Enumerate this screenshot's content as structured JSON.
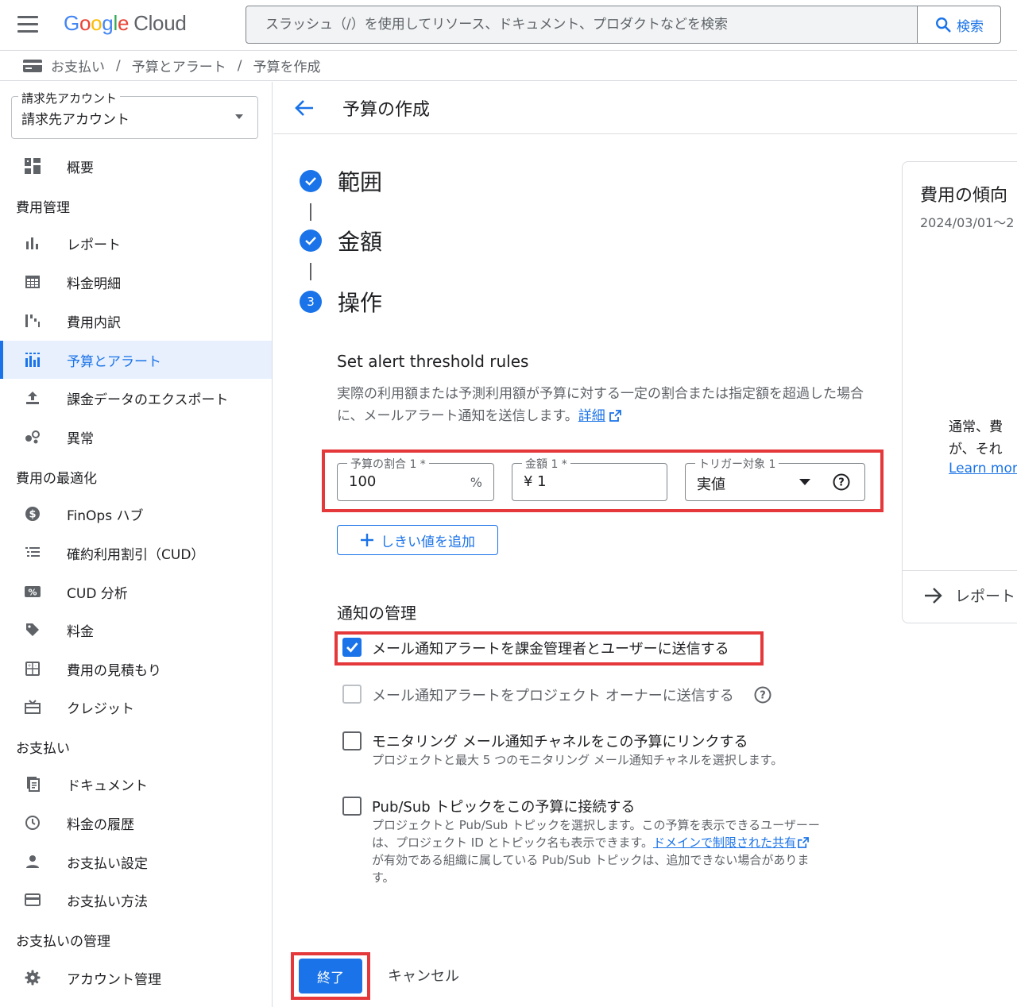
{
  "topbar": {
    "logo_letters": [
      "G",
      "o",
      "o",
      "g",
      "l",
      "e"
    ],
    "logo_cloud": "Cloud",
    "search_placeholder": "スラッシュ（/）を使用してリソース、ドキュメント、プロダクトなどを検索",
    "search_button": "検索"
  },
  "breadcrumb": {
    "items": [
      "お支払い",
      "予算とアラート",
      "予算を作成"
    ],
    "separator": "/"
  },
  "sidebar": {
    "account_label": "請求先アカウント",
    "account_value": "請求先アカウント",
    "overview": "概要",
    "sections": {
      "cost_management": "費用管理",
      "optimization": "費用の最適化",
      "payments": "お支払い",
      "payment_admin": "お支払いの管理"
    },
    "items": {
      "reports": "レポート",
      "pricing_table": "料金明細",
      "cost_breakdown": "費用内訳",
      "budgets": "予算とアラート",
      "export": "課金データのエクスポート",
      "anomalies": "異常",
      "finops": "FinOps ハブ",
      "cud": "確約利用割引（CUD）",
      "cud_analysis": "CUD 分析",
      "pricing": "料金",
      "estimate": "費用の見積もり",
      "credits": "クレジット",
      "documents": "ドキュメント",
      "transactions": "料金の履歴",
      "payment_settings": "お支払い設定",
      "payment_method": "お支払い方法",
      "account_management": "アカウント管理"
    }
  },
  "main": {
    "title": "予算の作成",
    "steps": [
      {
        "label": "範囲",
        "state": "done"
      },
      {
        "label": "金額",
        "state": "done"
      },
      {
        "label": "操作",
        "state": "active",
        "number": "3"
      }
    ],
    "rules_heading": "Set alert threshold rules",
    "rules_desc": "実際の利用額または予測利用額が予算に対する一定の割合または指定額を超過した場合に、メールアラート通知を送信します。",
    "rules_link": "詳細",
    "threshold": {
      "percent_label": "予算の割合 1 *",
      "percent_value": "100",
      "percent_suffix": "%",
      "amount_label": "金額 1 *",
      "amount_value": "¥ 1",
      "trigger_label": "トリガー対象 1",
      "trigger_value": "実値"
    },
    "add_threshold": "しきい値を追加",
    "notify_heading": "通知の管理",
    "checkboxes": {
      "email_admins": {
        "label": "メール通知アラートを課金管理者とユーザーに送信する",
        "checked": true
      },
      "email_owners": {
        "label": "メール通知アラートをプロジェクト オーナーに送信する",
        "checked": false,
        "disabled": true
      },
      "monitoring": {
        "label": "モニタリング メール通知チャネルをこの予算にリンクする",
        "sub": "プロジェクトと最大 5 つのモニタリング メール通知チャネルを選択します。",
        "checked": false
      },
      "pubsub": {
        "label": "Pub/Sub トピックをこの予算に接続する",
        "sub1": "プロジェクトと Pub/Sub トピックを選択します。この予算を表示できるユーザー",
        "sub2": "ー",
        "sub3": "は、プロジェクト ID とトピック名も表示できます。",
        "sub_link": "ドメインで制限された共有",
        "sub4": "が有効である組織に属している Pub/Sub トピックは、追加できない場合がありま",
        "sub5": "す。",
        "checked": false
      }
    },
    "finish": "終了",
    "cancel": "キャンセル"
  },
  "card": {
    "title": "費用の傾向",
    "date": "2024/03/01〜2",
    "body_line1": "通常、費",
    "body_line2": "が、それ",
    "link": "Learn more",
    "footer": "レポート"
  },
  "colors": {
    "accent": "#1a73e8",
    "highlight_red": "#e5383b",
    "active_nav_bg": "#e8f0fe"
  }
}
